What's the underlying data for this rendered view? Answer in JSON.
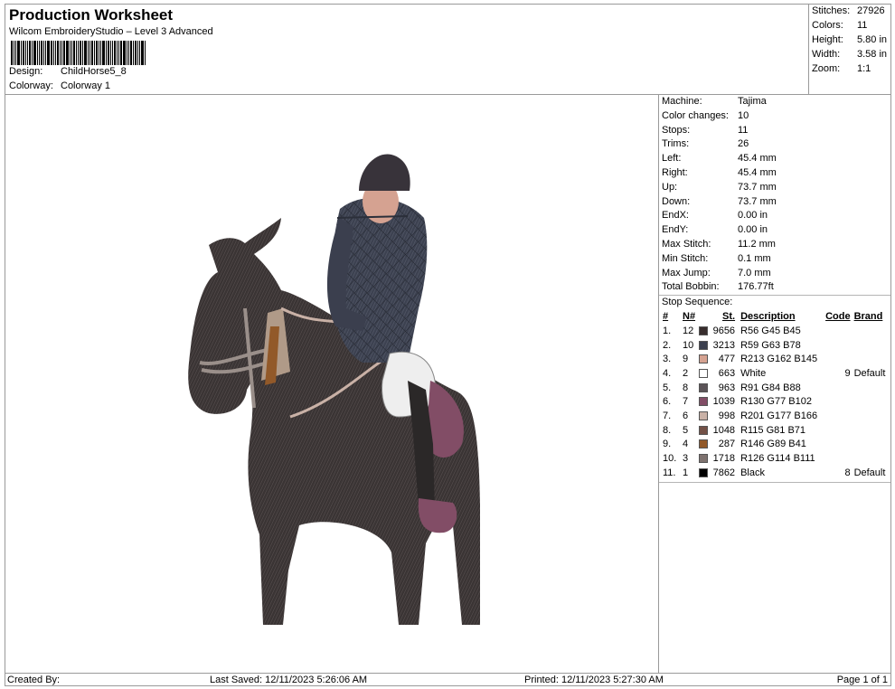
{
  "header": {
    "title": "Production Worksheet",
    "software": "Wilcom EmbroideryStudio – Level 3 Advanced",
    "design_label": "Design:",
    "design_value": "ChildHorse5_8",
    "colorway_label": "Colorway:",
    "colorway_value": "Colorway 1"
  },
  "summary": [
    {
      "label": "Stitches:",
      "value": "27926"
    },
    {
      "label": "Colors:",
      "value": "11"
    },
    {
      "label": "Height:",
      "value": "5.80 in"
    },
    {
      "label": "Width:",
      "value": "3.58 in"
    },
    {
      "label": "Zoom:",
      "value": "1:1"
    }
  ],
  "specs": [
    {
      "label": "Machine:",
      "value": "Tajima"
    },
    {
      "label": "Color changes:",
      "value": "10"
    },
    {
      "label": "Stops:",
      "value": "11"
    },
    {
      "label": "Trims:",
      "value": "26"
    },
    {
      "label": "Left:",
      "value": "45.4 mm"
    },
    {
      "label": "Right:",
      "value": "45.4 mm"
    },
    {
      "label": "Up:",
      "value": "73.7 mm"
    },
    {
      "label": "Down:",
      "value": "73.7 mm"
    },
    {
      "label": "EndX:",
      "value": "0.00 in"
    },
    {
      "label": "EndY:",
      "value": "0.00 in"
    },
    {
      "label": "Max Stitch:",
      "value": "11.2 mm"
    },
    {
      "label": "Min Stitch:",
      "value": "0.1 mm"
    },
    {
      "label": "Max Jump:",
      "value": "7.0 mm"
    },
    {
      "label": "Total Bobbin:",
      "value": "176.77ft"
    }
  ],
  "stop_sequence": {
    "title": "Stop Sequence:",
    "headers": {
      "num": "#",
      "n": "N#",
      "st": "St.",
      "desc": "Description",
      "code": "Code",
      "brand": "Brand"
    },
    "rows": [
      {
        "num": "1.",
        "n": "12",
        "color": "#382d2d",
        "st": "9656",
        "desc": "R56 G45 B45",
        "code": "",
        "brand": ""
      },
      {
        "num": "2.",
        "n": "10",
        "color": "#3b3f4e",
        "st": "3213",
        "desc": "R59 G63 B78",
        "code": "",
        "brand": ""
      },
      {
        "num": "3.",
        "n": "9",
        "color": "#d5a291",
        "st": "477",
        "desc": "R213 G162 B145",
        "code": "",
        "brand": ""
      },
      {
        "num": "4.",
        "n": "2",
        "color": "#ffffff",
        "st": "663",
        "desc": "White",
        "code": "9",
        "brand": "Default"
      },
      {
        "num": "5.",
        "n": "8",
        "color": "#5b5458",
        "st": "963",
        "desc": "R91 G84 B88",
        "code": "",
        "brand": ""
      },
      {
        "num": "6.",
        "n": "7",
        "color": "#824d66",
        "st": "1039",
        "desc": "R130 G77 B102",
        "code": "",
        "brand": ""
      },
      {
        "num": "7.",
        "n": "6",
        "color": "#c9b1a6",
        "st": "998",
        "desc": "R201 G177 B166",
        "code": "",
        "brand": ""
      },
      {
        "num": "8.",
        "n": "5",
        "color": "#735147",
        "st": "1048",
        "desc": "R115 G81 B71",
        "code": "",
        "brand": ""
      },
      {
        "num": "9.",
        "n": "4",
        "color": "#925929",
        "st": "287",
        "desc": "R146 G89 B41",
        "code": "",
        "brand": ""
      },
      {
        "num": "10.",
        "n": "3",
        "color": "#7e726f",
        "st": "1718",
        "desc": "R126 G114 B111",
        "code": "",
        "brand": ""
      },
      {
        "num": "11.",
        "n": "1",
        "color": "#000000",
        "st": "7862",
        "desc": "Black",
        "code": "8",
        "brand": "Default"
      }
    ]
  },
  "footer": {
    "created_by": "Created By:",
    "last_saved": "Last Saved: 12/11/2023 5:26:06 AM",
    "printed": "Printed: 12/11/2023 5:27:30 AM",
    "page": "Page 1 of 1"
  }
}
